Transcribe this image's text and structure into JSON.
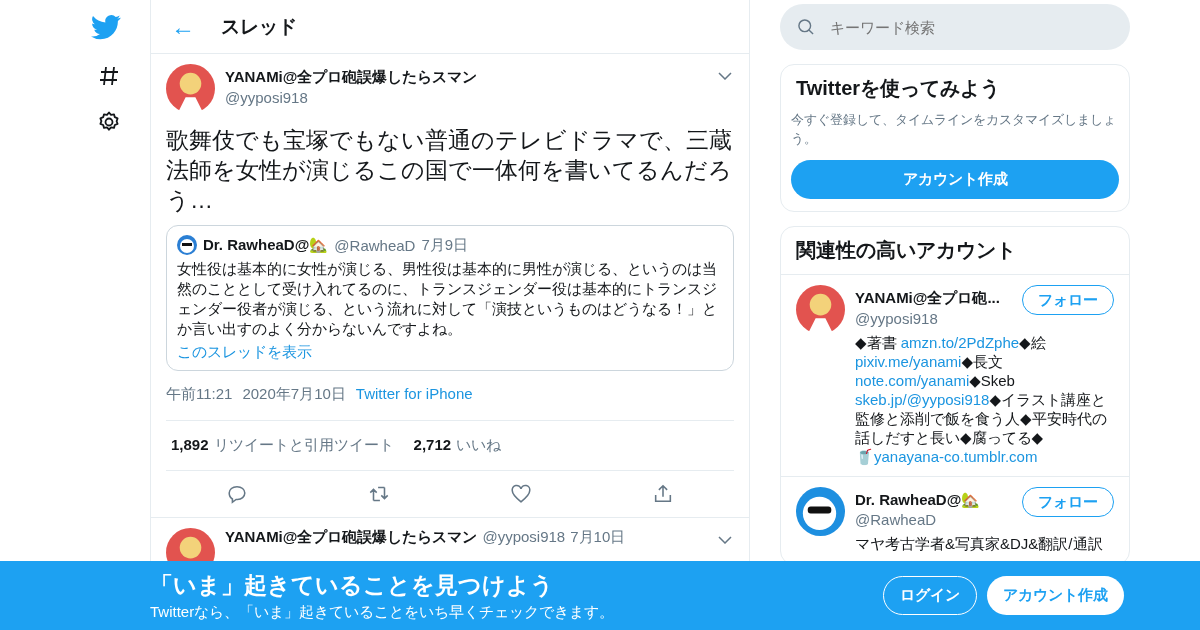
{
  "header": {
    "back": "←",
    "title": "スレッド"
  },
  "tweet": {
    "name": "YANAMi@全プロ砲誤爆したらスマン",
    "handle": "@yyposi918",
    "text": "歌舞伎でも宝塚でもない普通のテレビドラマで、三蔵法師を女性が演じるこの国で一体何を書いてるんだろう…",
    "quote": {
      "name": "Dr. RawheaD@🏡",
      "handle": "@RawheaD",
      "date": "7月9日",
      "text": "女性役は基本的に女性が演じる、男性役は基本的に男性が演じる、というのは当然のこととして受け入れてるのに、トランスジェンダー役は基本的にトランスジェンダー役者が演じる、という流れに対して「演技というものはどうなる！」とか言い出すのよく分からないんですよね。",
      "link": "このスレッドを表示"
    },
    "time": "午前11:21",
    "date": "2020年7月10日",
    "source": "Twitter for iPhone",
    "stats": [
      {
        "count": "1,892",
        "label": "リツイートと引用ツイート"
      },
      {
        "count": "2,712",
        "label": "いいね"
      }
    ]
  },
  "reply": {
    "name": "YANAMi@全プロ砲誤爆したらスマン",
    "handle": "@yyposi918",
    "date": "7月10日"
  },
  "search": {
    "placeholder": "キーワード検索"
  },
  "signup_card": {
    "title": "Twitterを使ってみよう",
    "text": "今すぐ登録して、タイムラインをカスタマイズしましょう。",
    "button": "アカウント作成"
  },
  "accounts": {
    "title": "関連性の高いアカウント",
    "items": [
      {
        "name": "YANAMi@全プロ砲...",
        "handle": "@yyposi918",
        "follow": "フォロー",
        "bio": [
          {
            "kind": "text",
            "text": "◆著書 "
          },
          {
            "kind": "link",
            "text": "amzn.to/2PdZphe"
          },
          {
            "kind": "text",
            "text": "◆絵 "
          },
          {
            "kind": "link",
            "text": "pixiv.me/yanami"
          },
          {
            "kind": "text",
            "text": "◆長文 "
          },
          {
            "kind": "link",
            "text": "note.com/yanami"
          },
          {
            "kind": "text",
            "text": "◆Skeb "
          },
          {
            "kind": "link",
            "text": "skeb.jp/@yyposi918"
          },
          {
            "kind": "text",
            "text": "◆イラスト講座と監修と添削で飯を食う人◆平安時代の話しだすと長い◆腐ってる◆ "
          },
          {
            "kind": "link",
            "text": "🥤yanayana-co.tumblr.com"
          }
        ]
      },
      {
        "name": "Dr. RawheaD@🏡",
        "handle": "@RawheaD",
        "follow": "フォロー",
        "bio": [
          {
            "kind": "text",
            "text": "マヤ考古学者&写真家&DJ&翻訳/通訳"
          }
        ]
      }
    ]
  },
  "banner": {
    "title": "「いま」起きていることを見つけよう",
    "subtitle": "Twitterなら、「いま」起きていることをいち早くチェックできます。",
    "login": "ログイン",
    "signup": "アカウント作成"
  }
}
